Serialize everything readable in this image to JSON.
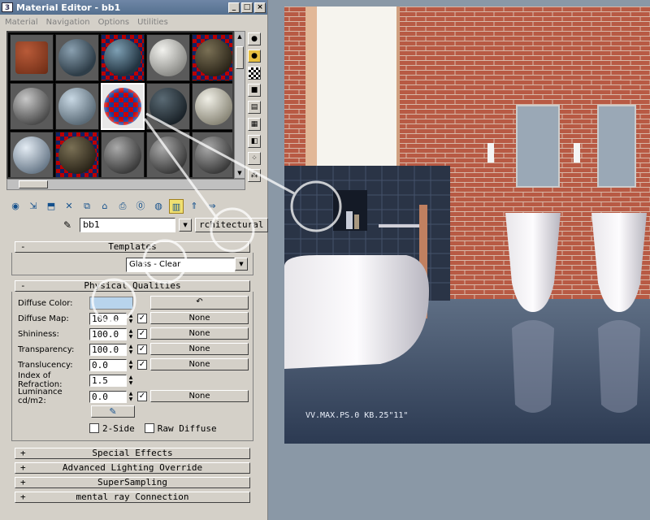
{
  "window": {
    "title": "Material Editor - bb1",
    "minimize": "_",
    "maximize": "□",
    "close": "×"
  },
  "menu": [
    "Material",
    "Navigation",
    "Options",
    "Utilities"
  ],
  "material": {
    "name": "bb1",
    "type_label": "rchitectural"
  },
  "templates": {
    "header": "Templates",
    "selected": "Glass - Clear"
  },
  "physical": {
    "header": "Physical Qualities",
    "diffuse_color_label": "Diffuse Color:",
    "diffuse_color": "#b8d4ec",
    "rows": [
      {
        "label": "Diffuse Map:",
        "value": "100.0",
        "checked": "✓",
        "map": "None"
      },
      {
        "label": "Shininess:",
        "value": "100.0",
        "checked": "✓",
        "map": "None"
      },
      {
        "label": "Transparency:",
        "value": "100.0",
        "checked": "✓",
        "map": "None"
      },
      {
        "label": "Translucency:",
        "value": "0.0",
        "checked": "✓",
        "map": "None"
      }
    ],
    "ior_label": "Index of Refraction:",
    "ior_value": "1.5",
    "luminance_label": "Luminance cd/m2:",
    "luminance_value": "0.0",
    "luminance_checked": "✓",
    "luminance_map": "None",
    "two_side_label": "2-Side",
    "raw_diffuse_label": "Raw Diffuse"
  },
  "rollouts": [
    "Special Effects",
    "Advanced Lighting Override",
    "SuperSampling",
    "mental ray Connection"
  ],
  "render": {
    "watermark": "VV.MAX.PS.0 KB.25\"11\""
  }
}
